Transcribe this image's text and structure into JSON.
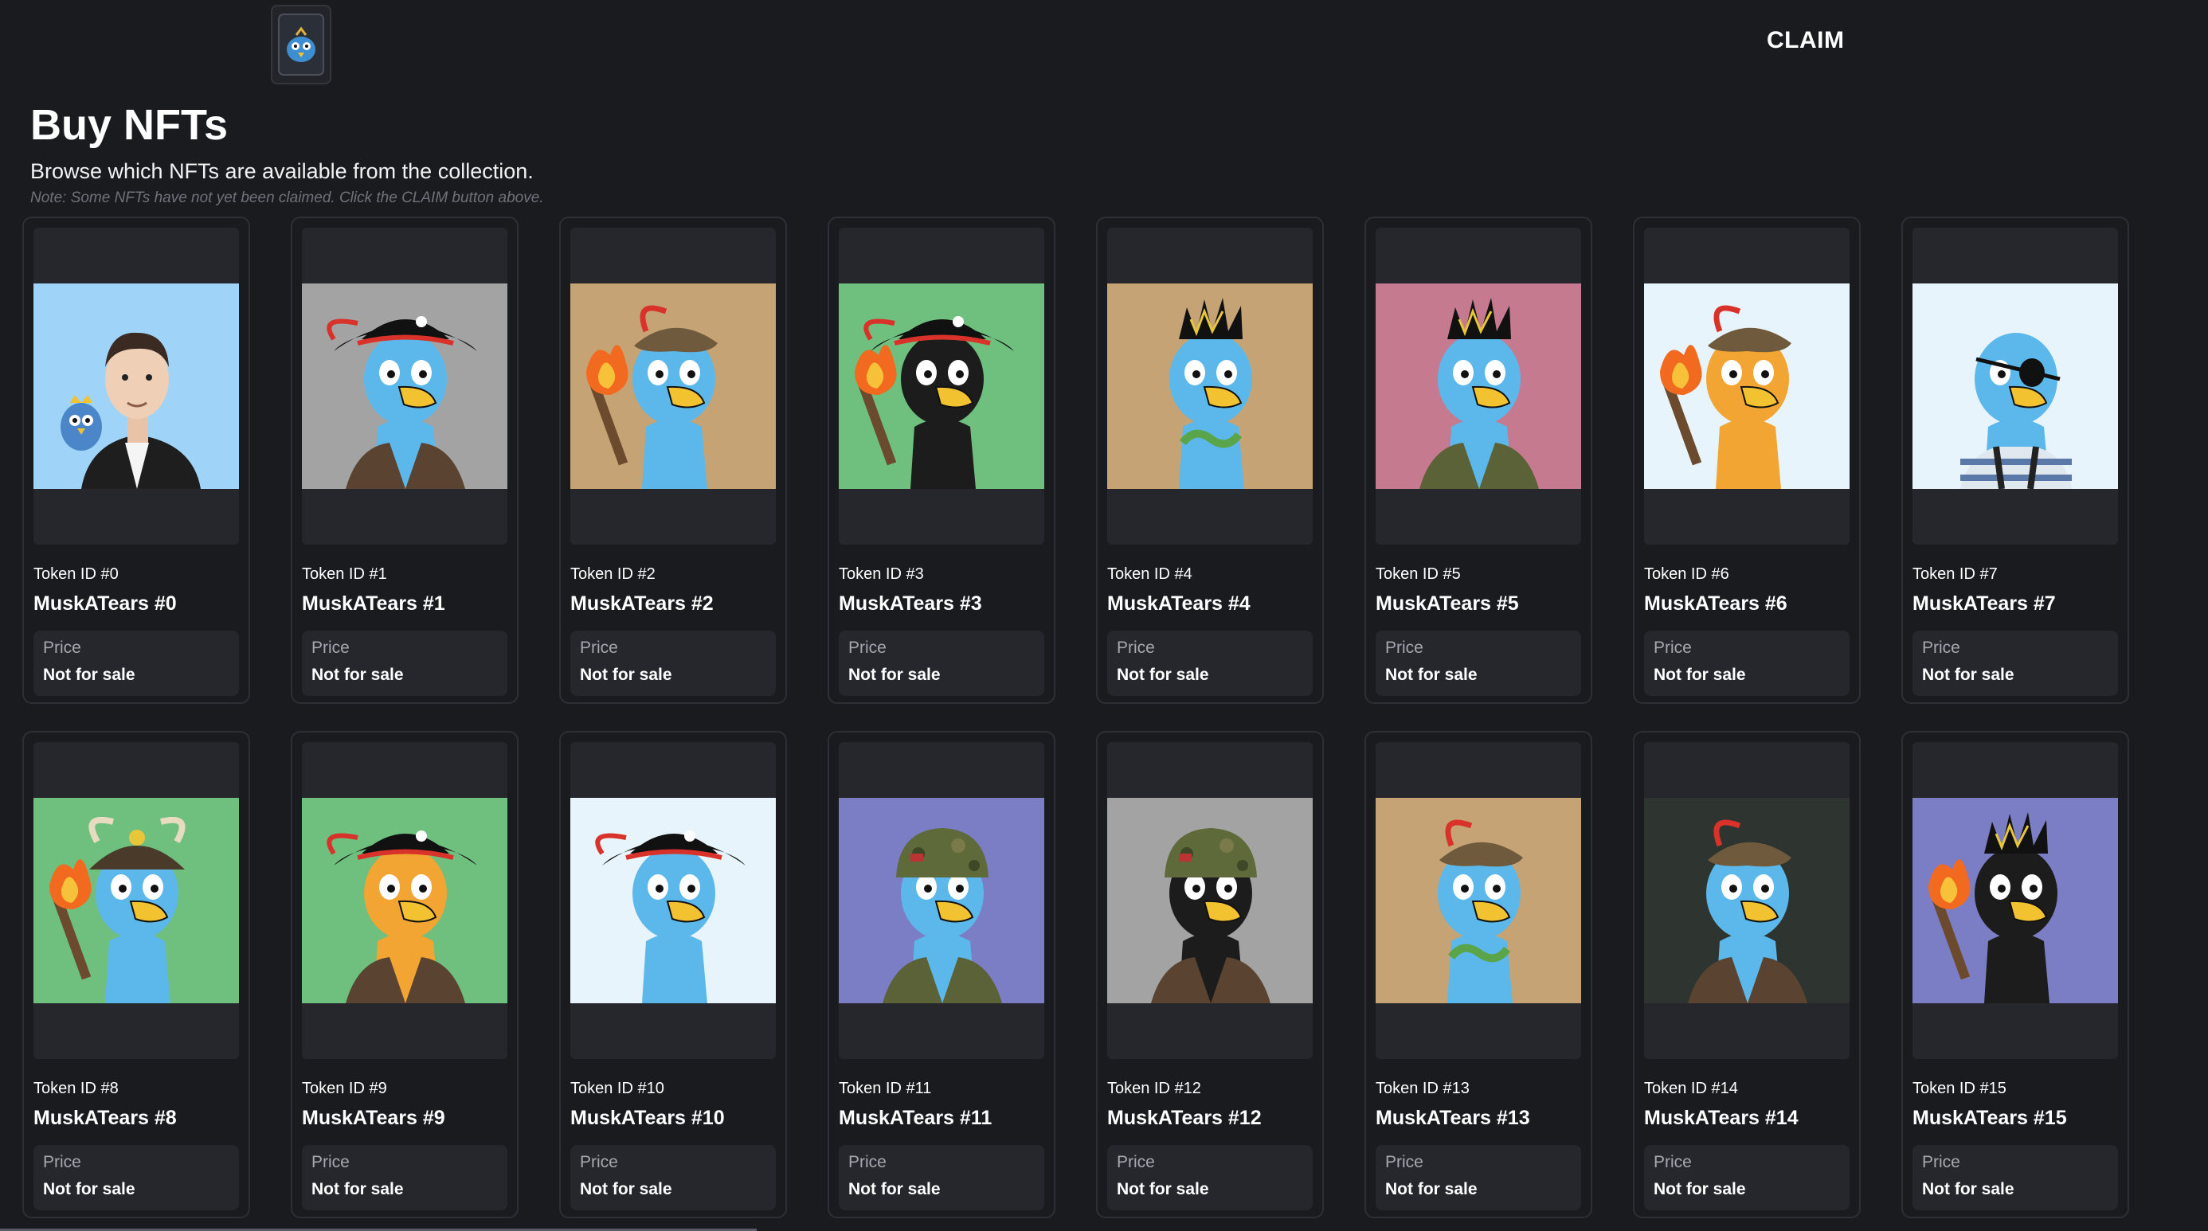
{
  "header": {
    "claim_label": "CLAIM"
  },
  "page": {
    "title": "Buy NFTs",
    "subtitle": "Browse which NFTs are available from the collection.",
    "note": "Note: Some NFTs have not yet been claimed. Click the CLAIM button above."
  },
  "colors": {
    "background": "#1a1b1f",
    "card_border": "#2d2f36",
    "panel": "#26272c"
  },
  "nfts": [
    {
      "token_label": "Token ID #0",
      "name": "MuskATears #0",
      "price_label": "Price",
      "price_value": "Not for sale",
      "bg": "#9fd3f7",
      "body": "#5aa9e6",
      "hat": "none",
      "extra": "human"
    },
    {
      "token_label": "Token ID #1",
      "name": "MuskATears #1",
      "price_label": "Price",
      "price_value": "Not for sale",
      "bg": "#a3a3a3",
      "body": "#5cb8ea",
      "hat": "pirate",
      "extra": "jacket"
    },
    {
      "token_label": "Token ID #2",
      "name": "MuskATears #2",
      "price_label": "Price",
      "price_value": "Not for sale",
      "bg": "#c5a374",
      "body": "#5cb8ea",
      "hat": "feather",
      "extra": "torch"
    },
    {
      "token_label": "Token ID #3",
      "name": "MuskATears #3",
      "price_label": "Price",
      "price_value": "Not for sale",
      "bg": "#6fbf7f",
      "body": "#1c1c1c",
      "hat": "pirate",
      "extra": "torch"
    },
    {
      "token_label": "Token ID #4",
      "name": "MuskATears #4",
      "price_label": "Price",
      "price_value": "Not for sale",
      "bg": "#c5a374",
      "body": "#5cb8ea",
      "hat": "spike",
      "extra": "snake"
    },
    {
      "token_label": "Token ID #5",
      "name": "MuskATears #5",
      "price_label": "Price",
      "price_value": "Not for sale",
      "bg": "#c67a90",
      "body": "#5cb8ea",
      "hat": "spike",
      "extra": "camo"
    },
    {
      "token_label": "Token ID #6",
      "name": "MuskATears #6",
      "price_label": "Price",
      "price_value": "Not for sale",
      "bg": "#e8f4fb",
      "body": "#f2a533",
      "hat": "feather",
      "extra": "torch"
    },
    {
      "token_label": "Token ID #7",
      "name": "MuskATears #7",
      "price_label": "Price",
      "price_value": "Not for sale",
      "bg": "#e8f4fb",
      "body": "#5cb8ea",
      "hat": "eyepatch",
      "extra": "stripes"
    },
    {
      "token_label": "Token ID #8",
      "name": "MuskATears #8",
      "price_label": "Price",
      "price_value": "Not for sale",
      "bg": "#6fbf7f",
      "body": "#5cb8ea",
      "hat": "samurai",
      "extra": "torch"
    },
    {
      "token_label": "Token ID #9",
      "name": "MuskATears #9",
      "price_label": "Price",
      "price_value": "Not for sale",
      "bg": "#6fbf7f",
      "body": "#f2a533",
      "hat": "pirate",
      "extra": "jacket"
    },
    {
      "token_label": "Token ID #10",
      "name": "MuskATears #10",
      "price_label": "Price",
      "price_value": "Not for sale",
      "bg": "#e8f4fb",
      "body": "#5cb8ea",
      "hat": "pirate",
      "extra": "none"
    },
    {
      "token_label": "Token ID #11",
      "name": "MuskATears #11",
      "price_label": "Price",
      "price_value": "Not for sale",
      "bg": "#7b7ec4",
      "body": "#5cb8ea",
      "hat": "helmet",
      "extra": "camo"
    },
    {
      "token_label": "Token ID #12",
      "name": "MuskATears #12",
      "price_label": "Price",
      "price_value": "Not for sale",
      "bg": "#a3a3a3",
      "body": "#1c1c1c",
      "hat": "helmet",
      "extra": "jacket"
    },
    {
      "token_label": "Token ID #13",
      "name": "MuskATears #13",
      "price_label": "Price",
      "price_value": "Not for sale",
      "bg": "#c5a374",
      "body": "#5cb8ea",
      "hat": "feather",
      "extra": "snake"
    },
    {
      "token_label": "Token ID #14",
      "name": "MuskATears #14",
      "price_label": "Price",
      "price_value": "Not for sale",
      "bg": "#2e3430",
      "body": "#5cb8ea",
      "hat": "feather",
      "extra": "jacket"
    },
    {
      "token_label": "Token ID #15",
      "name": "MuskATears #15",
      "price_label": "Price",
      "price_value": "Not for sale",
      "bg": "#7b7ec4",
      "body": "#1c1c1c",
      "hat": "spike",
      "extra": "torch"
    }
  ]
}
